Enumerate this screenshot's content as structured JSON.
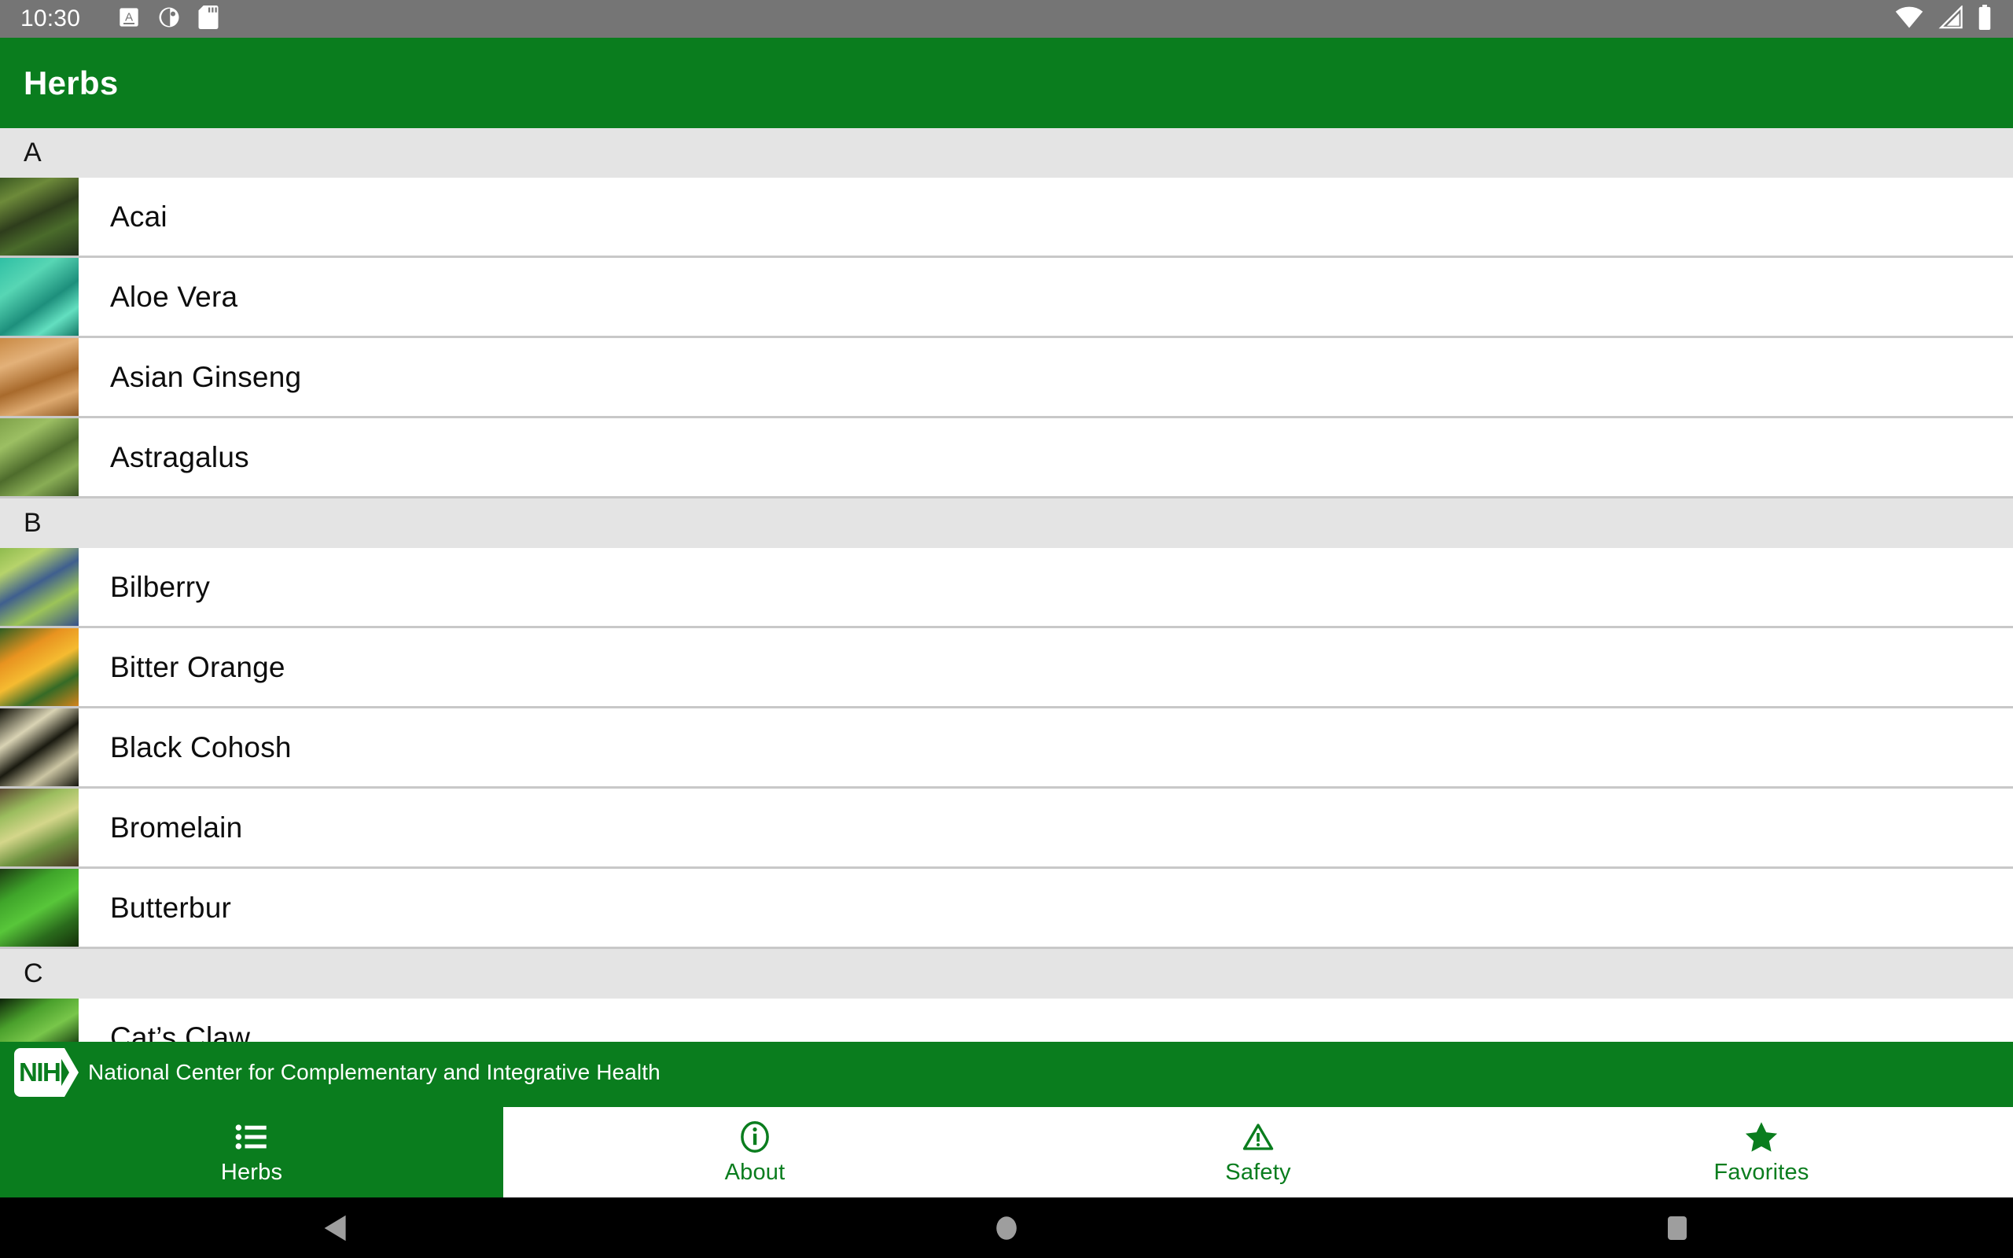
{
  "status_bar": {
    "time": "10:30",
    "left_icons": [
      "keyboard-language-icon",
      "dnd-icon",
      "sd-card-icon"
    ],
    "right_icons": [
      "wifi-icon",
      "cellular-signal-icon",
      "battery-icon"
    ],
    "background": "#757575"
  },
  "app_bar": {
    "title": "Herbs",
    "background": "#0a7d1e",
    "text_color": "#ffffff"
  },
  "list": {
    "sections": [
      {
        "letter": "A",
        "items": [
          {
            "name": "Acai",
            "thumb": "acai-thumbnail"
          },
          {
            "name": "Aloe Vera",
            "thumb": "aloe-vera-thumbnail"
          },
          {
            "name": "Asian Ginseng",
            "thumb": "asian-ginseng-thumbnail"
          },
          {
            "name": "Astragalus",
            "thumb": "astragalus-thumbnail"
          }
        ]
      },
      {
        "letter": "B",
        "items": [
          {
            "name": "Bilberry",
            "thumb": "bilberry-thumbnail"
          },
          {
            "name": "Bitter Orange",
            "thumb": "bitter-orange-thumbnail"
          },
          {
            "name": "Black Cohosh",
            "thumb": "black-cohosh-thumbnail"
          },
          {
            "name": "Bromelain",
            "thumb": "bromelain-thumbnail"
          },
          {
            "name": "Butterbur",
            "thumb": "butterbur-thumbnail"
          }
        ]
      },
      {
        "letter": "C",
        "items": [
          {
            "name": "Cat’s Claw",
            "thumb": "cats-claw-thumbnail"
          }
        ]
      }
    ],
    "section_header_background": "#e4e4e4",
    "row_divider_color": "#c8c8c8"
  },
  "nih_banner": {
    "logo_text": "NIH",
    "text": "National Center for Complementary and Integrative Health",
    "background": "#0a7d1e"
  },
  "tab_bar": {
    "accent": "#0a7d1e",
    "tabs": [
      {
        "label": "Herbs",
        "icon": "list-icon",
        "active": true
      },
      {
        "label": "About",
        "icon": "info-circle-icon",
        "active": false
      },
      {
        "label": "Safety",
        "icon": "warning-triangle-icon",
        "active": false
      },
      {
        "label": "Favorites",
        "icon": "star-icon",
        "active": false
      }
    ]
  },
  "nav_bar": {
    "buttons": [
      "back-button",
      "home-button",
      "recents-button"
    ],
    "background": "#000000"
  }
}
